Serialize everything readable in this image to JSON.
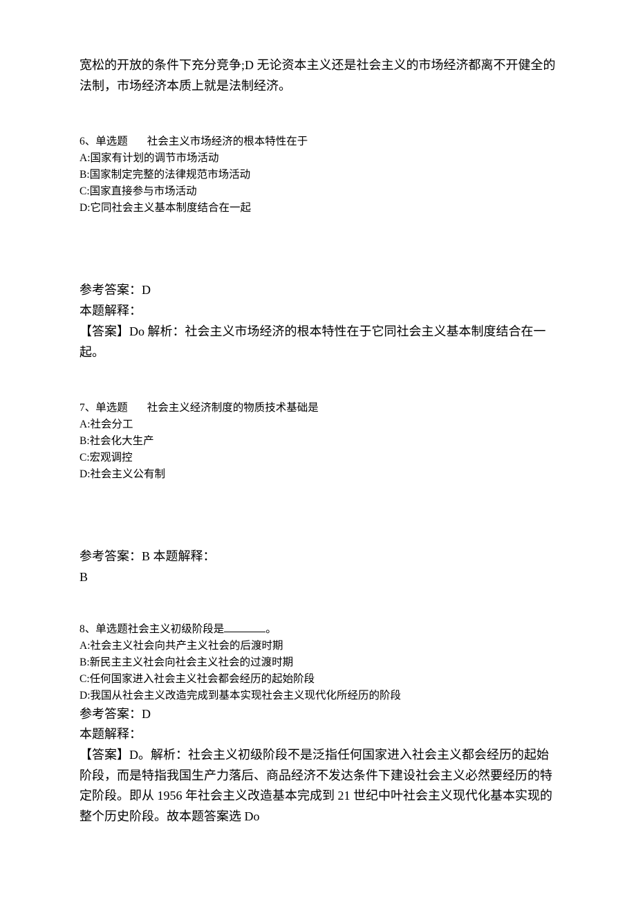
{
  "intro_paragraph": "宽松的开放的条件下充分竞争;D 无论资本主义还是社会主义的市场经济都离不开健全的法制，市场经济本质上就是法制经济。",
  "q6": {
    "stem_prefix": "6、单选题",
    "stem_text": "社会主义市场经济的根本特性在于",
    "A": "A:国家有计划的调节市场活动",
    "B": "B:国家制定完整的法律规范市场活动",
    "C": "C:国家直接参与市场活动",
    "D": "D:它同社会主义基本制度结合在一起",
    "ref_answer": "参考答案：D",
    "explain_label": "本题解释：",
    "explain_body": "【答案】Do 解析：社会主义市场经济的根本特性在于它同社会主义基本制度结合在一起。"
  },
  "q7": {
    "stem_prefix": "7、单选题",
    "stem_text": "社会主义经济制度的物质技术基础是",
    "A": "A:社会分工",
    "B": "B:社会化大生产",
    "C": "C:宏观调控",
    "D": "D:社会主义公有制",
    "ref_answer": "参考答案：B 本题解释：",
    "explain_body": "B"
  },
  "q8": {
    "stem_prefix": "8、单选题社会主义初级阶段是",
    "stem_suffix": "。",
    "A": "A:社会主义社会向共产主义社会的后渡时期",
    "B": "B:新民主主义社会向社会主义社会的过渡时期",
    "C": "C:任何国家进入社会主义社会都会经历的起始阶段",
    "D": "D:我国从社会主义改造完成到基本实现社会主义现代化所经历的阶段",
    "ref_answer": "参考答案：D",
    "explain_label": "本题解释：",
    "explain_body": "【答案】D。解析：社会主义初级阶段不是泛指任何国家进入社会主义都会经历的起始阶段，而是特指我国生产力落后、商品经济不发达条件下建设社会主义必然要经历的特定阶段。即从 1956 年社会主义改造基本完成到 21 世纪中叶社会主义现代化基本实现的整个历史阶段。故本题答案选 Do"
  }
}
